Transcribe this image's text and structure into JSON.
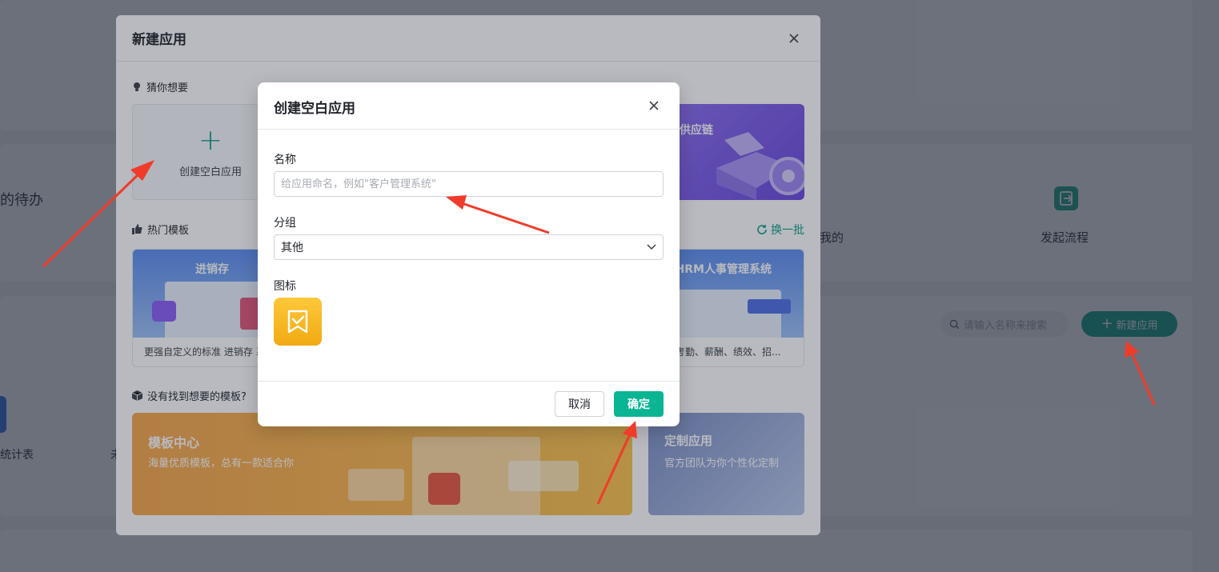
{
  "background": {
    "todo_label": "的待办",
    "mine_label": "我的",
    "start_flow_label": "发起流程",
    "stat_label": "统计表",
    "partial_label": "未",
    "search_placeholder": "请输入名称来搜索",
    "new_app_label": "新建应用"
  },
  "outer_modal": {
    "title": "新建应用",
    "guess_label": "猜你想要",
    "blank_card_label": "创建空白应用",
    "purple_card_label": "购供应链",
    "hot_label": "热门模板",
    "refresh_label": "换一批",
    "templates": [
      {
        "title": "进销存",
        "desc": "更强自定义的标准 进销存 系"
      },
      {
        "title": "HRM人事管理系统",
        "desc": "工、考勤、薪酬、绩效、招..."
      }
    ],
    "not_found_label": "没有找到想要的模板?",
    "template_center": {
      "title": "模板中心",
      "subtitle": "海量优质模板，总有一款适合你"
    },
    "custom_app": {
      "title": "定制应用",
      "subtitle": "官方团队为你个性化定制"
    }
  },
  "inner_modal": {
    "title": "创建空白应用",
    "name_label": "名称",
    "name_placeholder": "给应用命名，例如\"客户管理系统\"",
    "name_value": "",
    "group_label": "分组",
    "group_value": "其他",
    "icon_label": "图标",
    "cancel_label": "取消",
    "ok_label": "确定"
  },
  "colors": {
    "accent": "#0ab594",
    "brand_dark": "#0a9e87",
    "icon_yellow": "#f6b41d",
    "annotation_red": "#f03b2a"
  },
  "icons": {
    "outer_close": "close-icon",
    "inner_close": "close-icon",
    "select_arrow": "chevron-down-icon",
    "app_icon": "bookmark-check-icon",
    "guess": "lightbulb-icon",
    "hot": "thumbs-up-icon",
    "not_found": "box-icon",
    "refresh": "refresh-icon",
    "search": "search-icon"
  }
}
